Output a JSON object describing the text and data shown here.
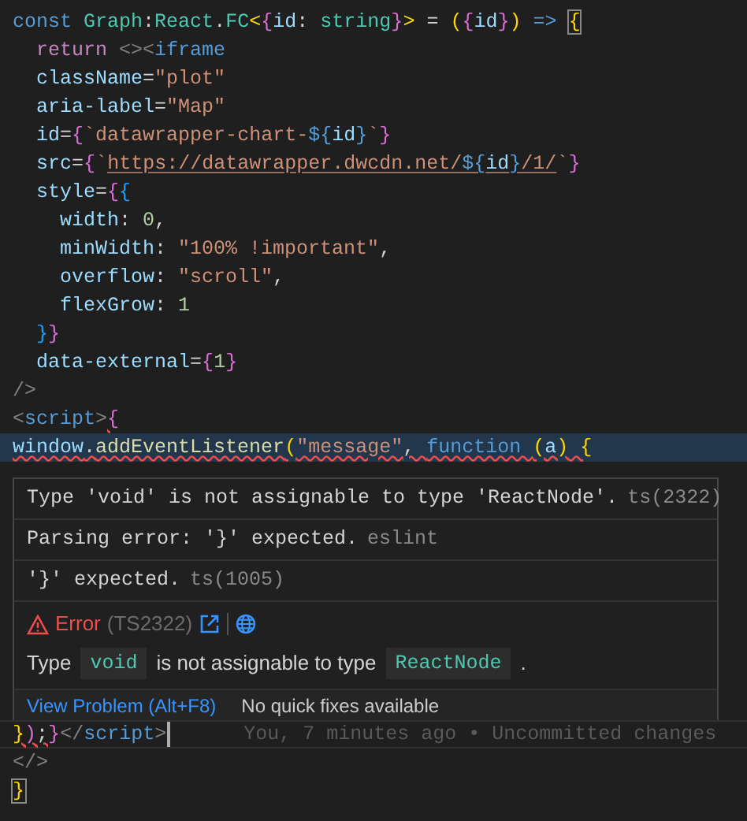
{
  "code_lines": [
    {
      "tokens": [
        {
          "kind": "kw",
          "text": "const "
        },
        {
          "kind": "type",
          "text": "Graph"
        },
        {
          "kind": "plain",
          "text": ":"
        },
        {
          "kind": "type",
          "text": "React"
        },
        {
          "kind": "plain",
          "text": "."
        },
        {
          "kind": "type",
          "text": "FC"
        },
        {
          "kind": "b1",
          "text": "<"
        },
        {
          "kind": "b2",
          "text": "{"
        },
        {
          "kind": "var",
          "text": "id"
        },
        {
          "kind": "plain",
          "text": ": "
        },
        {
          "kind": "type",
          "text": "string"
        },
        {
          "kind": "b2",
          "text": "}"
        },
        {
          "kind": "b1",
          "text": ">"
        },
        {
          "kind": "plain",
          "text": " = "
        },
        {
          "kind": "b1",
          "text": "("
        },
        {
          "kind": "b2",
          "text": "{"
        },
        {
          "kind": "var",
          "text": "id"
        },
        {
          "kind": "b2",
          "text": "}"
        },
        {
          "kind": "b1",
          "text": ")"
        },
        {
          "kind": "kw",
          "text": " => "
        },
        {
          "kind": "b1",
          "text": "{",
          "match": true
        }
      ]
    },
    {
      "tokens": [
        {
          "kind": "ctrl",
          "text": "  return "
        },
        {
          "kind": "tagp",
          "text": "<><"
        },
        {
          "kind": "kw",
          "text": "iframe"
        }
      ]
    },
    {
      "tokens": [
        {
          "kind": "var",
          "text": "  className"
        },
        {
          "kind": "plain",
          "text": "="
        },
        {
          "kind": "str",
          "text": "\"plot\""
        }
      ]
    },
    {
      "tokens": [
        {
          "kind": "var",
          "text": "  aria-label"
        },
        {
          "kind": "plain",
          "text": "="
        },
        {
          "kind": "str",
          "text": "\"Map\""
        }
      ]
    },
    {
      "tokens": [
        {
          "kind": "var",
          "text": "  id"
        },
        {
          "kind": "plain",
          "text": "="
        },
        {
          "kind": "b2",
          "text": "{"
        },
        {
          "kind": "str",
          "text": "`datawrapper-chart-"
        },
        {
          "kind": "kw",
          "text": "${"
        },
        {
          "kind": "var",
          "text": "id"
        },
        {
          "kind": "kw",
          "text": "}"
        },
        {
          "kind": "str",
          "text": "`"
        },
        {
          "kind": "b2",
          "text": "}"
        }
      ]
    },
    {
      "tokens": [
        {
          "kind": "var",
          "text": "  src"
        },
        {
          "kind": "plain",
          "text": "="
        },
        {
          "kind": "b2",
          "text": "{"
        },
        {
          "kind": "str",
          "text": "`"
        },
        {
          "kind": "str",
          "text": "https://datawrapper.dwcdn.net/",
          "link": true
        },
        {
          "kind": "kw",
          "text": "${",
          "link": true
        },
        {
          "kind": "var",
          "text": "id",
          "link": true
        },
        {
          "kind": "kw",
          "text": "}",
          "link": true
        },
        {
          "kind": "str",
          "text": "/1/",
          "link": true
        },
        {
          "kind": "str",
          "text": "`"
        },
        {
          "kind": "b2",
          "text": "}"
        }
      ]
    },
    {
      "tokens": [
        {
          "kind": "var",
          "text": "  style"
        },
        {
          "kind": "plain",
          "text": "="
        },
        {
          "kind": "b2",
          "text": "{"
        },
        {
          "kind": "b3",
          "text": "{"
        }
      ]
    },
    {
      "tokens": [
        {
          "kind": "var",
          "text": "    width"
        },
        {
          "kind": "plain",
          "text": ": "
        },
        {
          "kind": "num",
          "text": "0"
        },
        {
          "kind": "plain",
          "text": ","
        }
      ]
    },
    {
      "tokens": [
        {
          "kind": "var",
          "text": "    minWidth"
        },
        {
          "kind": "plain",
          "text": ": "
        },
        {
          "kind": "str",
          "text": "\"100% !important\""
        },
        {
          "kind": "plain",
          "text": ","
        }
      ]
    },
    {
      "tokens": [
        {
          "kind": "var",
          "text": "    overflow"
        },
        {
          "kind": "plain",
          "text": ": "
        },
        {
          "kind": "str",
          "text": "\"scroll\""
        },
        {
          "kind": "plain",
          "text": ","
        }
      ]
    },
    {
      "tokens": [
        {
          "kind": "var",
          "text": "    flexGrow"
        },
        {
          "kind": "plain",
          "text": ": "
        },
        {
          "kind": "num",
          "text": "1"
        }
      ]
    },
    {
      "tokens": [
        {
          "kind": "b3",
          "text": "  }"
        },
        {
          "kind": "b2",
          "text": "}"
        }
      ]
    },
    {
      "tokens": [
        {
          "kind": "var",
          "text": "  data-external"
        },
        {
          "kind": "plain",
          "text": "="
        },
        {
          "kind": "b2",
          "text": "{"
        },
        {
          "kind": "num",
          "text": "1"
        },
        {
          "kind": "b2",
          "text": "}"
        }
      ]
    },
    {
      "tokens": [
        {
          "kind": "tagp",
          "text": "/>"
        }
      ]
    },
    {
      "tokens": [
        {
          "kind": "tagp",
          "text": "<"
        },
        {
          "kind": "kw",
          "text": "script"
        },
        {
          "kind": "tagp",
          "text": ">"
        },
        {
          "kind": "b2",
          "text": "{",
          "error": true
        }
      ]
    },
    {
      "tokens": [
        {
          "kind": "var",
          "text": "window",
          "error": true
        },
        {
          "kind": "plain",
          "text": ".",
          "error": true
        },
        {
          "kind": "fn",
          "text": "addEventListener",
          "error": true
        },
        {
          "kind": "b1",
          "text": "(",
          "error": true
        },
        {
          "kind": "str",
          "text": "\"message\"",
          "error": true
        },
        {
          "kind": "plain",
          "text": ", ",
          "error": true
        },
        {
          "kind": "kw",
          "text": "function ",
          "error": true
        },
        {
          "kind": "b1",
          "text": "(",
          "error": true
        },
        {
          "kind": "var",
          "text": "a",
          "error": true
        },
        {
          "kind": "b1",
          "text": ")",
          "error": true
        },
        {
          "kind": "b1",
          "text": " {",
          "error": true
        }
      ],
      "highlighted": true
    }
  ],
  "hover": {
    "messages": [
      {
        "text": "Type 'void' is not assignable to type 'ReactNode'.",
        "source": "ts(2322)"
      },
      {
        "text": "Parsing error: '}' expected.",
        "source": "eslint"
      },
      {
        "text": "'}' expected.",
        "source": "ts(1005)"
      }
    ],
    "detail": {
      "severity": "Error",
      "code": "(TS2322)",
      "parts": [
        {
          "kind": "text",
          "text": "Type"
        },
        {
          "kind": "code",
          "text": "void"
        },
        {
          "kind": "text",
          "text": "is not assignable to type"
        },
        {
          "kind": "code",
          "text": "ReactNode"
        },
        {
          "kind": "text",
          "text": "."
        }
      ]
    },
    "footer": {
      "link": "View Problem (Alt+F8)",
      "note": "No quick fixes available"
    }
  },
  "code_lines_after": [
    {
      "tokens": [
        {
          "kind": "b1",
          "text": "}",
          "error": true
        },
        {
          "kind": "b2",
          "text": ")",
          "error": true
        },
        {
          "kind": "plain",
          "text": ";",
          "error": true
        },
        {
          "kind": "b2",
          "text": "}"
        },
        {
          "kind": "tagp",
          "text": "</"
        },
        {
          "kind": "kw",
          "text": "script"
        },
        {
          "kind": "tagp",
          "text": ">"
        }
      ],
      "current": true,
      "blame": "You, 7 minutes ago • Uncommitted changes"
    },
    {
      "tokens": [
        {
          "kind": "tagp",
          "text": "</>"
        }
      ]
    },
    {
      "tokens": [
        {
          "kind": "b1",
          "text": "}",
          "match": true
        }
      ]
    }
  ]
}
